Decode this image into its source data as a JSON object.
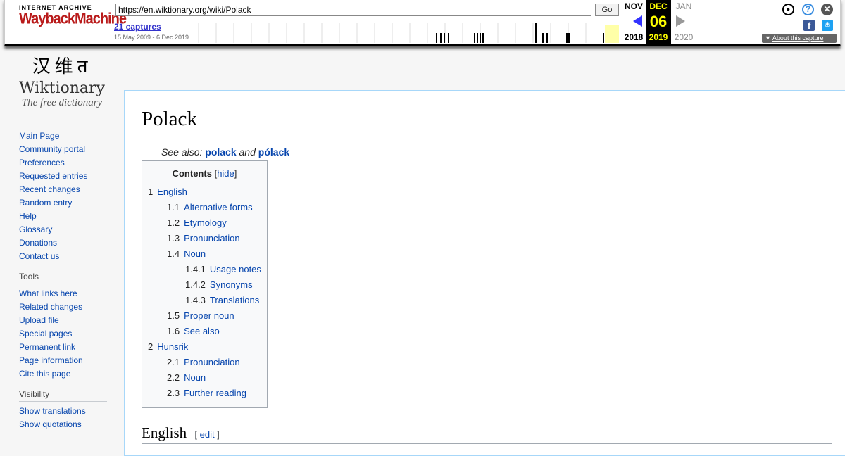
{
  "wayback": {
    "logo_top": "INTERNET ARCHIVE",
    "logo_main": "WaybackMachine",
    "url": "https://en.wiktionary.org/wiki/Polack",
    "go_label": "Go",
    "captures": "21 captures",
    "range": "15 May 2009 - 6 Dec 2019",
    "prev_month": "NOV",
    "prev_year": "2018",
    "cur_month": "DEC",
    "cur_day": "06",
    "cur_year": "2019",
    "next_month": "JAN",
    "next_year": "2020",
    "about": "About this capture",
    "accent": "#b91a1a",
    "current_bg": "#000000",
    "current_fg": "#ffff00"
  },
  "site": {
    "glyphs": "汉维त",
    "name": "Wiktionary",
    "tagline": "The free dictionary"
  },
  "sidebar": {
    "nav": [
      "Main Page",
      "Community portal",
      "Preferences",
      "Requested entries",
      "Recent changes",
      "Random entry",
      "Help",
      "Glossary",
      "Donations",
      "Contact us"
    ],
    "tools_heading": "Tools",
    "tools": [
      "What links here",
      "Related changes",
      "Upload file",
      "Special pages",
      "Permanent link",
      "Page information",
      "Cite this page"
    ],
    "visibility_heading": "Visibility",
    "visibility": [
      "Show translations",
      "Show quotations"
    ]
  },
  "page": {
    "title": "Polack",
    "see_also_prefix": "See also:",
    "see_also_1": "polack",
    "see_also_and": "and",
    "see_also_2": "pólack",
    "toc_title": "Contents",
    "toc_hide": "hide",
    "toc": [
      {
        "num": "1",
        "label": "English",
        "level": 1
      },
      {
        "num": "1.1",
        "label": "Alternative forms",
        "level": 2
      },
      {
        "num": "1.2",
        "label": "Etymology",
        "level": 2
      },
      {
        "num": "1.3",
        "label": "Pronunciation",
        "level": 2
      },
      {
        "num": "1.4",
        "label": "Noun",
        "level": 2
      },
      {
        "num": "1.4.1",
        "label": "Usage notes",
        "level": 3
      },
      {
        "num": "1.4.2",
        "label": "Synonyms",
        "level": 3
      },
      {
        "num": "1.4.3",
        "label": "Translations",
        "level": 3
      },
      {
        "num": "1.5",
        "label": "Proper noun",
        "level": 2
      },
      {
        "num": "1.6",
        "label": "See also",
        "level": 2
      },
      {
        "num": "2",
        "label": "Hunsrik",
        "level": 1
      },
      {
        "num": "2.1",
        "label": "Pronunciation",
        "level": 2
      },
      {
        "num": "2.2",
        "label": "Noun",
        "level": 2
      },
      {
        "num": "2.3",
        "label": "Further reading",
        "level": 2
      }
    ],
    "section_heading": "English",
    "edit_label": "edit"
  }
}
